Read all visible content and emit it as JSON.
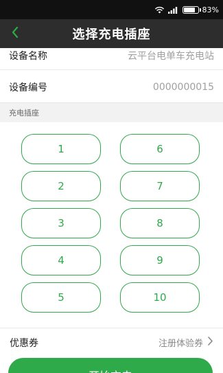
{
  "status_bar": {
    "battery": "83%",
    "battery_level": 0.83
  },
  "header": {
    "title": "选择充电插座"
  },
  "device": {
    "name_label": "设备名称",
    "name_value": "云平台电单车充电站",
    "id_label": "设备编号",
    "id_value": "0000000015"
  },
  "sockets": {
    "section_label": "充电插座",
    "items": [
      "1",
      "6",
      "2",
      "7",
      "3",
      "8",
      "4",
      "9",
      "5",
      "10"
    ]
  },
  "coupon": {
    "label": "优惠券",
    "value": "注册体验券"
  },
  "actions": {
    "start_label": "开始充电"
  },
  "colors": {
    "accent": "#2eaa4a",
    "title_bar": "#2d2d2d",
    "status_bar": "#111111"
  }
}
